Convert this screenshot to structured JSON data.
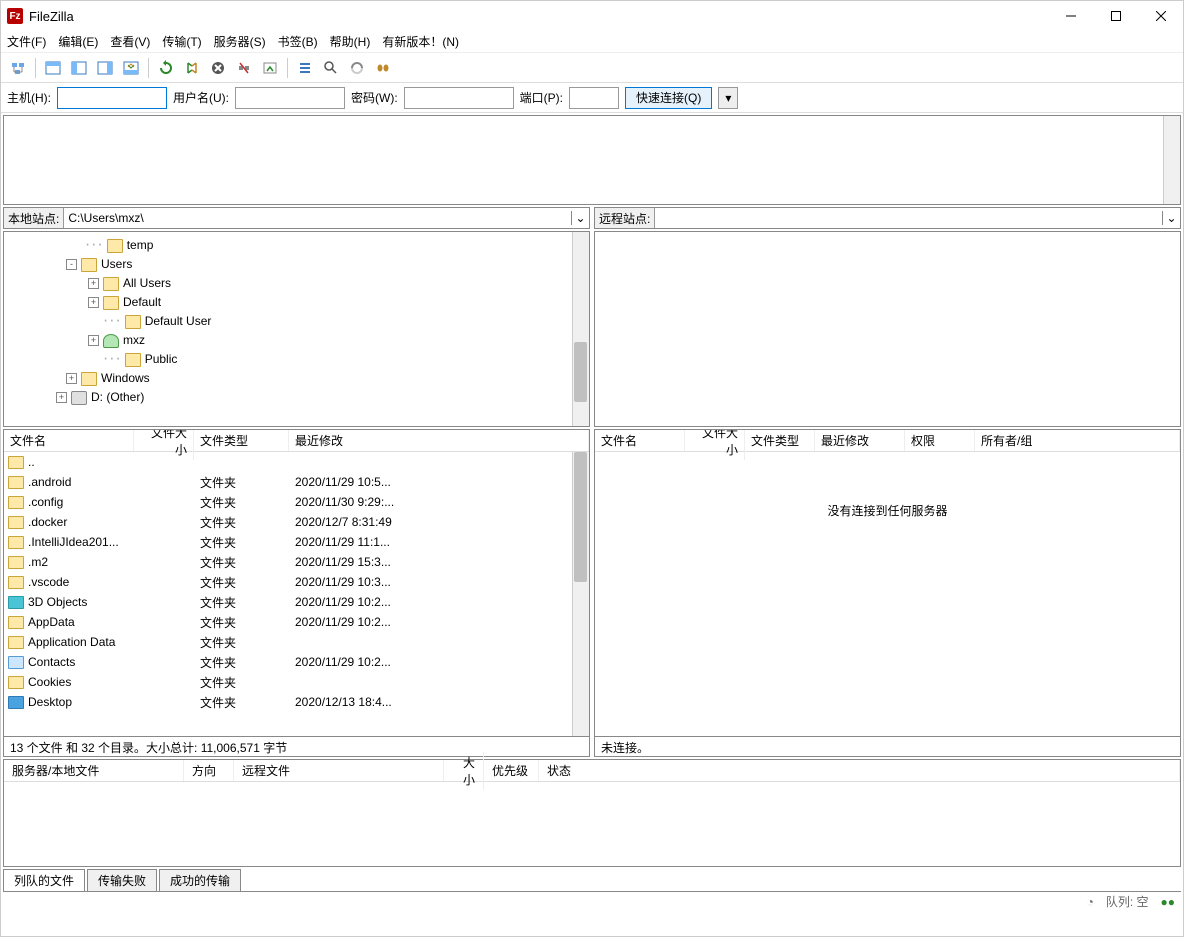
{
  "title": "FileZilla",
  "menu": [
    "文件(F)",
    "编辑(E)",
    "查看(V)",
    "传输(T)",
    "服务器(S)",
    "书签(B)",
    "帮助(H)",
    "有新版本！(N)"
  ],
  "quick": {
    "host_lbl": "主机(H):",
    "user_lbl": "用户名(U):",
    "pass_lbl": "密码(W):",
    "port_lbl": "端口(P):",
    "btn": "快速连接(Q)"
  },
  "local_site_lbl": "本地站点:",
  "local_site_path": "C:\\Users\\mxz\\",
  "remote_site_lbl": "远程站点:",
  "tree": [
    {
      "indent": 28,
      "exp": "",
      "label": "temp",
      "icon": "f"
    },
    {
      "indent": 10,
      "exp": "-",
      "label": "Users",
      "icon": "f"
    },
    {
      "indent": 32,
      "exp": "+",
      "label": "All Users",
      "icon": "f"
    },
    {
      "indent": 32,
      "exp": "+",
      "label": "Default",
      "icon": "f"
    },
    {
      "indent": 46,
      "exp": "",
      "label": "Default User",
      "icon": "f"
    },
    {
      "indent": 32,
      "exp": "+",
      "label": "mxz",
      "icon": "user"
    },
    {
      "indent": 46,
      "exp": "",
      "label": "Public",
      "icon": "f"
    },
    {
      "indent": 10,
      "exp": "+",
      "label": "Windows",
      "icon": "f"
    },
    {
      "indent": 0,
      "exp": "+",
      "label": "D: (Other)",
      "icon": "drive"
    }
  ],
  "local_cols": [
    "文件名",
    "文件大小",
    "文件类型",
    "最近修改"
  ],
  "remote_cols": [
    "文件名",
    "文件大小",
    "文件类型",
    "最近修改",
    "权限",
    "所有者/组"
  ],
  "files": [
    {
      "n": "..",
      "t": "",
      "m": "",
      "i": "f"
    },
    {
      "n": ".android",
      "t": "文件夹",
      "m": "2020/11/29 10:5...",
      "i": "f"
    },
    {
      "n": ".config",
      "t": "文件夹",
      "m": "2020/11/30 9:29:...",
      "i": "f"
    },
    {
      "n": ".docker",
      "t": "文件夹",
      "m": "2020/12/7 8:31:49",
      "i": "f"
    },
    {
      "n": ".IntelliJIdea201...",
      "t": "文件夹",
      "m": "2020/11/29 11:1...",
      "i": "f"
    },
    {
      "n": ".m2",
      "t": "文件夹",
      "m": "2020/11/29 15:3...",
      "i": "f"
    },
    {
      "n": ".vscode",
      "t": "文件夹",
      "m": "2020/11/29 10:3...",
      "i": "f"
    },
    {
      "n": "3D Objects",
      "t": "文件夹",
      "m": "2020/11/29 10:2...",
      "i": "teal"
    },
    {
      "n": "AppData",
      "t": "文件夹",
      "m": "2020/11/29 10:2...",
      "i": "f"
    },
    {
      "n": "Application Data",
      "t": "文件夹",
      "m": "",
      "i": "f"
    },
    {
      "n": "Contacts",
      "t": "文件夹",
      "m": "2020/11/29 10:2...",
      "i": "card"
    },
    {
      "n": "Cookies",
      "t": "文件夹",
      "m": "",
      "i": "f"
    },
    {
      "n": "Desktop",
      "t": "文件夹",
      "m": "2020/12/13 18:4...",
      "i": "blue"
    }
  ],
  "remote_empty": "没有连接到任何服务器",
  "local_status": "13 个文件 和 32 个目录。大小总计: 11,006,571 字节",
  "remote_status": "未连接。",
  "queue_cols": [
    "服务器/本地文件",
    "方向",
    "远程文件",
    "大小",
    "优先级",
    "状态"
  ],
  "tabs": [
    "列队的文件",
    "传输失败",
    "成功的传输"
  ],
  "bottom": {
    "q": "队列: 空"
  }
}
